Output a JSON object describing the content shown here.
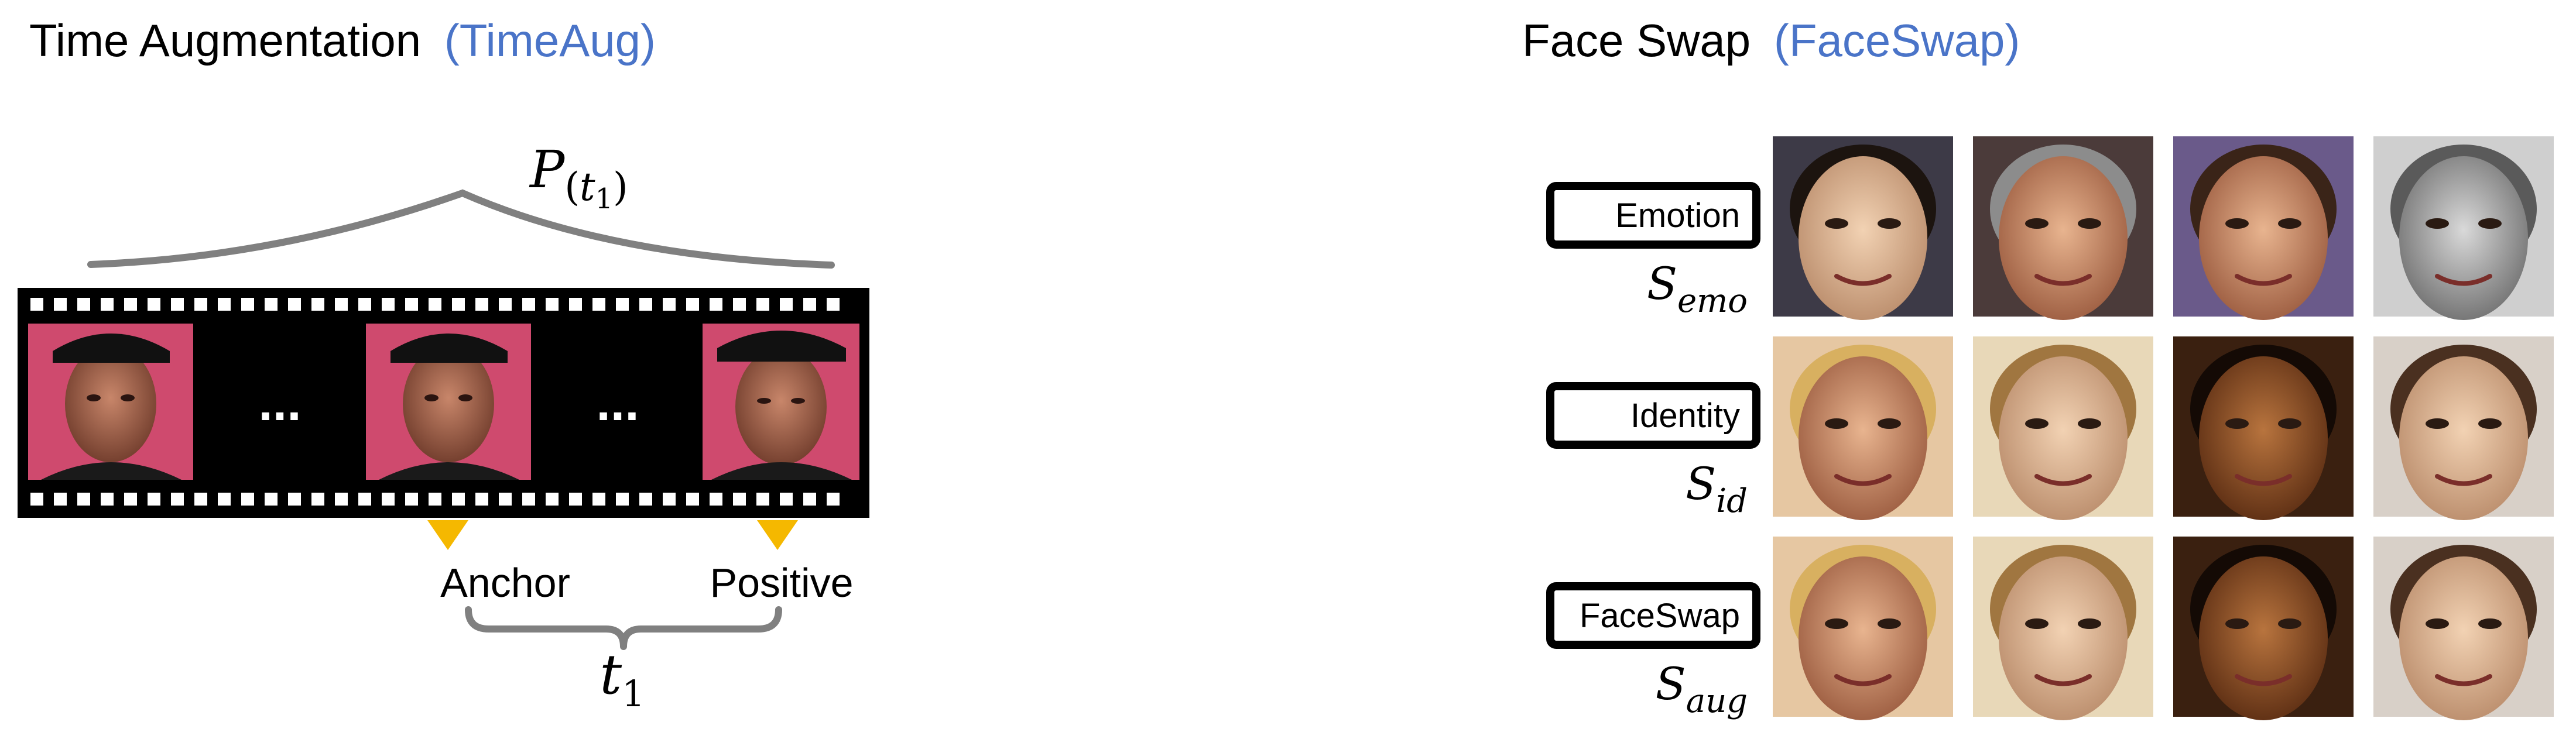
{
  "left": {
    "title": "Time Augmentation",
    "title_tag": "(TimeAug)",
    "prob_label": "P(t₁)",
    "ellipsis": "...",
    "anchor_label": "Anchor",
    "positive_label": "Positive",
    "interval_label": "t₁",
    "frame_count": 3,
    "colors": {
      "accent": "#4a74c8",
      "arrow": "#f5b800",
      "film": "#000000",
      "curve": "#808080",
      "face_bg": "#d0456a"
    }
  },
  "right": {
    "title": "Face Swap",
    "title_tag": "(FaceSwap)",
    "rows": [
      {
        "label": "Emotion",
        "symbol": "S",
        "subscript": "emo"
      },
      {
        "label": "Identity",
        "symbol": "S",
        "subscript": "id"
      },
      {
        "label": "FaceSwap",
        "symbol": "S",
        "subscript": "aug"
      }
    ],
    "face_grid": [
      [
        "face-photo",
        "face-photo",
        "face-photo",
        "face-photo"
      ],
      [
        "face-photo",
        "face-photo",
        "face-photo",
        "face-photo"
      ],
      [
        "face-photo",
        "face-photo",
        "face-photo",
        "face-photo"
      ]
    ]
  }
}
